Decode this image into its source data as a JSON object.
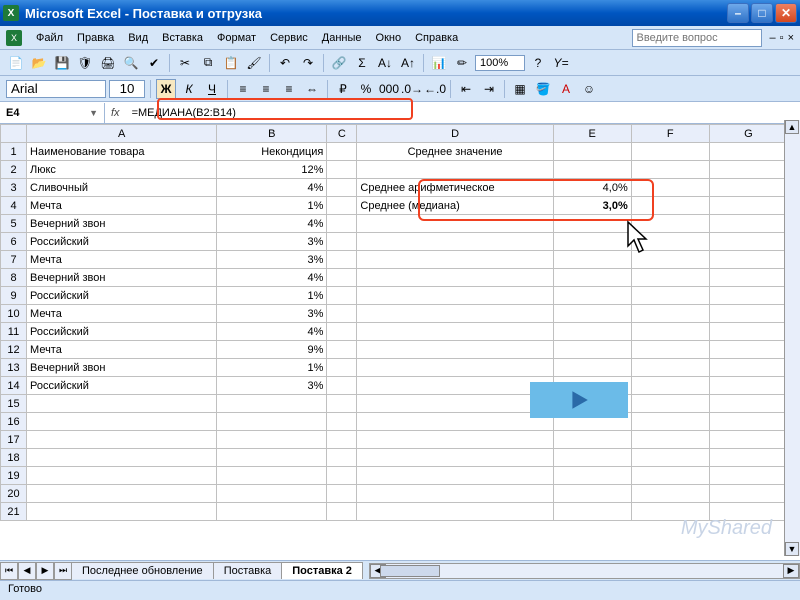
{
  "app": {
    "title": "Microsoft Excel - Поставка и отгрузка"
  },
  "menu": {
    "items": [
      "Файл",
      "Правка",
      "Вид",
      "Вставка",
      "Формат",
      "Сервис",
      "Данные",
      "Окно",
      "Справка"
    ],
    "help_placeholder": "Введите вопрос"
  },
  "toolbar": {
    "font": "Arial",
    "size": "10",
    "zoom": "100%"
  },
  "formula": {
    "namebox": "E4",
    "fx": "fx",
    "text": "=МЕДИАНА(B2:B14)"
  },
  "columns": [
    "A",
    "B",
    "C",
    "D",
    "E",
    "F",
    "G"
  ],
  "rows": [
    {
      "n": "1",
      "a": "Наименование товара",
      "b": "Некондиция",
      "d": "Среднее значение"
    },
    {
      "n": "2",
      "a": "Люкс",
      "b": "12%"
    },
    {
      "n": "3",
      "a": "Сливочный",
      "b": "4%",
      "d": "Среднее арифметическое",
      "e": "4,0%"
    },
    {
      "n": "4",
      "a": "Мечта",
      "b": "1%",
      "d": "Среднее (медиана)",
      "e": "3,0%"
    },
    {
      "n": "5",
      "a": "Вечерний звон",
      "b": "4%"
    },
    {
      "n": "6",
      "a": "Российский",
      "b": "3%"
    },
    {
      "n": "7",
      "a": "Мечта",
      "b": "3%"
    },
    {
      "n": "8",
      "a": "Вечерний звон",
      "b": "4%"
    },
    {
      "n": "9",
      "a": "Российский",
      "b": "1%"
    },
    {
      "n": "10",
      "a": "Мечта",
      "b": "3%"
    },
    {
      "n": "11",
      "a": "Российский",
      "b": "4%"
    },
    {
      "n": "12",
      "a": "Мечта",
      "b": "9%"
    },
    {
      "n": "13",
      "a": "Вечерний звон",
      "b": "1%"
    },
    {
      "n": "14",
      "a": "Российский",
      "b": "3%"
    },
    {
      "n": "15"
    },
    {
      "n": "16"
    },
    {
      "n": "17"
    },
    {
      "n": "18"
    },
    {
      "n": "19"
    },
    {
      "n": "20"
    },
    {
      "n": "21"
    }
  ],
  "tabs": {
    "items": [
      "Последнее обновление",
      "Поставка",
      "Поставка 2"
    ],
    "active": 2
  },
  "status": "Готово",
  "watermark": "MyShared"
}
